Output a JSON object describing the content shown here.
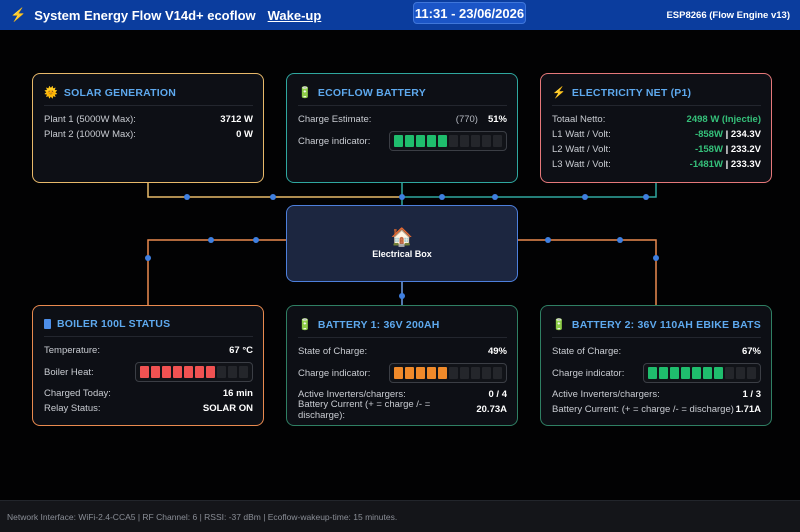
{
  "header": {
    "title": "System Energy Flow V14d+ ecoflow",
    "wake_link": "Wake-up",
    "clock": "11:31 - 23/06/2026",
    "engine": "ESP8266 (Flow Engine v13)"
  },
  "colors": {
    "header_bg": "#0b3d9e",
    "title_accent": "#5ea9ee",
    "solar_border": "#e8b96a",
    "ecoflow_border": "#2fa79f",
    "net_border": "#e5787a",
    "boiler_border": "#e98a4f",
    "battery1_border": "#2f7f63",
    "battery2_border": "#2f7f63",
    "positive": "#35c07a"
  },
  "solar": {
    "icon": "sun-icon",
    "title": "SOLAR GENERATION",
    "rows": [
      {
        "label": "Plant 1 (5000W Max):",
        "value": "3712 W"
      },
      {
        "label": "Plant 2 (1000W Max):",
        "value": "0 W"
      }
    ]
  },
  "ecoflow": {
    "icon": "battery-icon",
    "title": "ECOFLOW BATTERY",
    "estimate_label": "Charge Estimate:",
    "estimate_raw": "(770)",
    "estimate_value": "51%",
    "indicator_label": "Charge indicator:",
    "level": 0.51
  },
  "net": {
    "icon": "lightning-icon",
    "title": "ELECTRICITY NET (P1)",
    "total_label": "Totaal Netto:",
    "total_value": "2498 W (Injectie)",
    "phases": [
      {
        "label": "L1 Watt / Volt:",
        "watt": "-858W",
        "volt": "| 234.3V"
      },
      {
        "label": "L2 Watt / Volt:",
        "watt": "-158W",
        "volt": "| 233.2V"
      },
      {
        "label": "L3 Watt / Volt:",
        "watt": "-1481W",
        "volt": "| 233.3V"
      }
    ]
  },
  "electrical_box": {
    "icon": "house-icon",
    "label": "Electrical Box"
  },
  "boiler": {
    "icon": "boiler-icon",
    "title": "BOILER 100L STATUS",
    "temp_label": "Temperature:",
    "temp_value": "67 °C",
    "heat_label": "Boiler Heat:",
    "heat_level": 0.67,
    "charged_label": "Charged Today:",
    "charged_value": "16 min",
    "relay_label": "Relay Status:",
    "relay_value": "SOLAR ON"
  },
  "battery1": {
    "icon": "battery-icon",
    "title": "BATTERY 1: 36V 200AH",
    "soc_label": "State of Charge:",
    "soc_value": "49%",
    "indicator_label": "Charge indicator:",
    "level": 0.49,
    "inverters_label": "Active Inverters/chargers:",
    "inverters_value": "0 / 4",
    "current_label": "Battery Current (+ = charge /- = discharge):",
    "current_value": "20.73A"
  },
  "battery2": {
    "icon": "battery-icon",
    "title": "BATTERY 2: 36V 110AH EBIKE BATS",
    "soc_label": "State of Charge:",
    "soc_value": "67%",
    "indicator_label": "Charge indicator:",
    "level": 0.67,
    "inverters_label": "Active Inverters/chargers:",
    "inverters_value": "1 / 3",
    "current_label": "Battery Current: (+ = charge /- = discharge)",
    "current_value": "1.71A"
  },
  "footer": {
    "text": "Network Interface: WiFi-2.4-CCA5 | RF Channel: 6 | RSSI: -37 dBm | Ecoflow-wakeup-time: 15 minutes."
  }
}
